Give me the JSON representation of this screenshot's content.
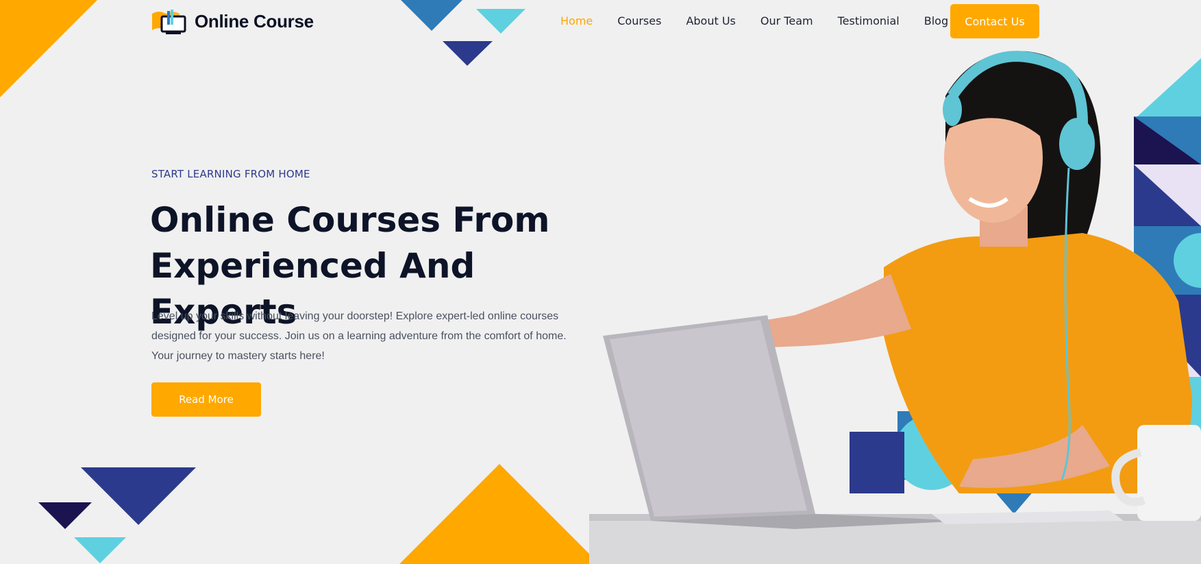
{
  "brand": {
    "name": "Online Course",
    "logo_icon": "open-book-monitor-icon"
  },
  "nav": {
    "items": [
      {
        "label": "Home",
        "active": true
      },
      {
        "label": "Courses",
        "active": false
      },
      {
        "label": "About Us",
        "active": false
      },
      {
        "label": "Our Team",
        "active": false
      },
      {
        "label": "Testimonial",
        "active": false
      },
      {
        "label": "Blog",
        "active": false
      }
    ],
    "cta_label": "Contact Us"
  },
  "hero": {
    "eyebrow": "START LEARNING FROM HOME",
    "title_line1": "Online Courses From",
    "title_line2": "Experienced And Experts",
    "description": "Level up your skills without leaving your doorstep! Explore expert-led online courses designed for your success. Join us on a learning adventure from the comfort of home. Your journey to mastery starts here!",
    "button_label": "Read More"
  },
  "colors": {
    "accent": "#ffa800",
    "active_nav": "#ffa500",
    "navy": "#2b3a8c",
    "cyan": "#5fd0e0",
    "dark_navy": "#1c1450",
    "background": "#f0f0f0"
  }
}
